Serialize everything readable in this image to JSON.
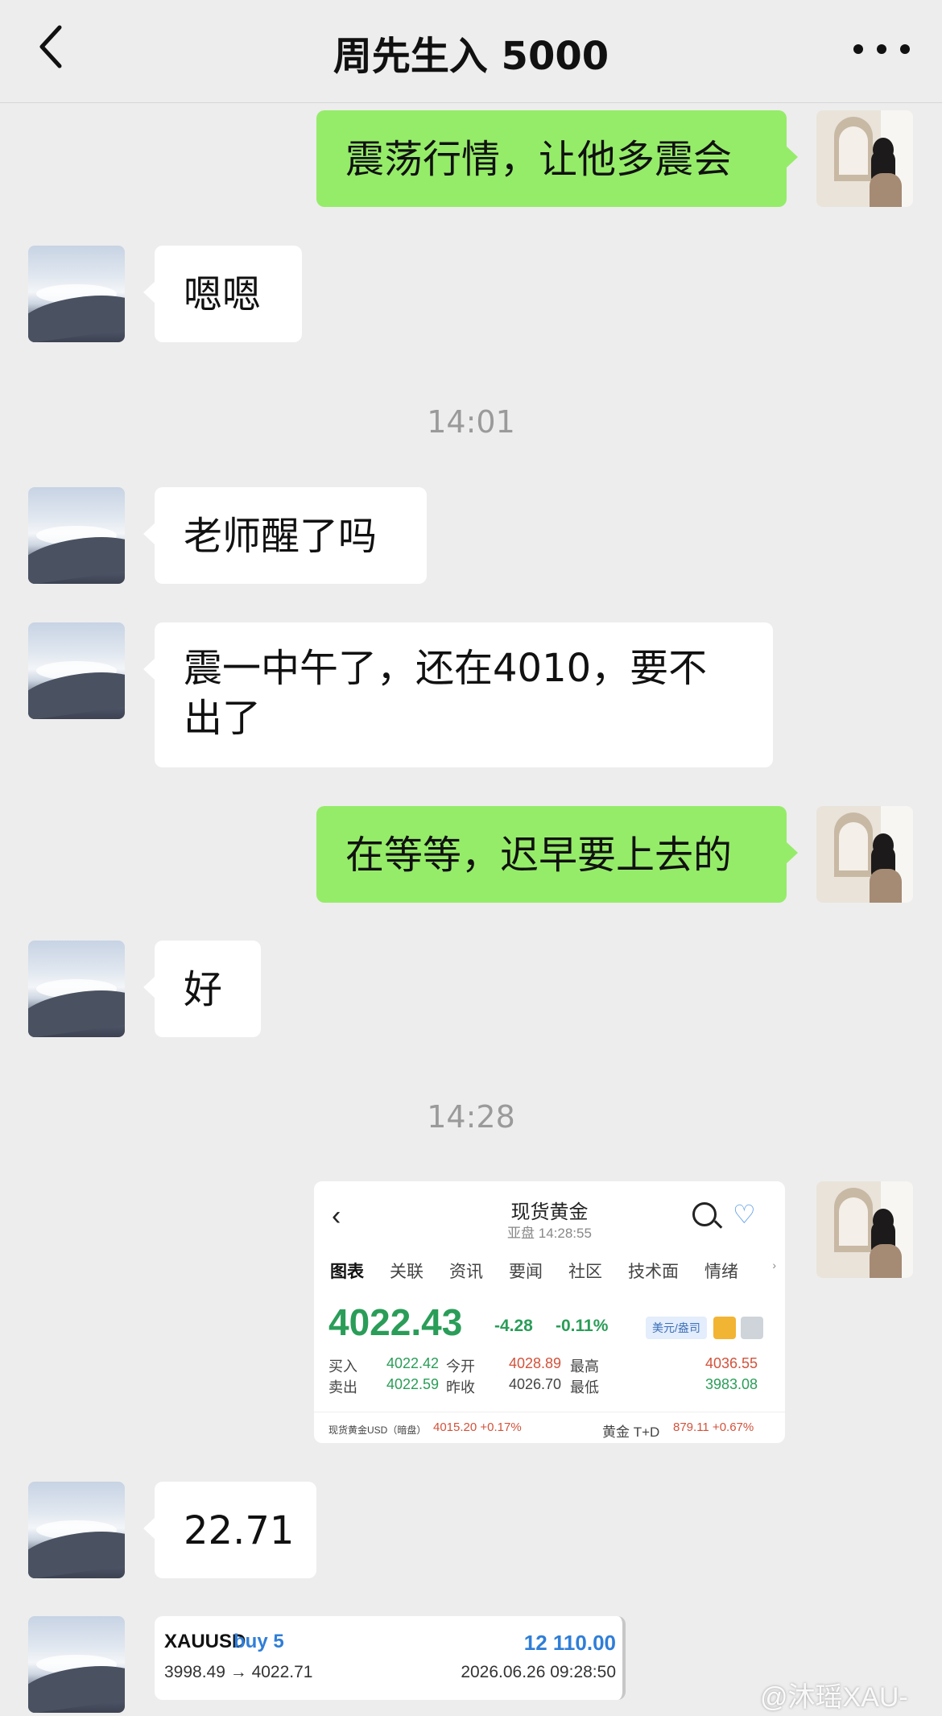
{
  "header": {
    "title": "周先生入 5000"
  },
  "messages": [
    {
      "from": "me",
      "text": "震荡行情，让他多震会"
    },
    {
      "from": "them",
      "text": "嗯嗯"
    },
    {
      "time": "14:01"
    },
    {
      "from": "them",
      "text": "老师醒了吗"
    },
    {
      "from": "them",
      "text_line1": "震一中午了，还在4010，要不",
      "text_line2": "出了"
    },
    {
      "from": "me",
      "text": "在等等，迟早要上去的"
    },
    {
      "from": "them",
      "text": "好"
    },
    {
      "time": "14:28"
    },
    {
      "from": "them",
      "text": "22.71"
    }
  ],
  "quote_screenshot": {
    "back_glyph": "‹",
    "title": "现货黄金",
    "subtitle": "亚盘 14:28:55",
    "heart_glyph": "♡",
    "tabs": [
      "图表",
      "关联",
      "资讯",
      "要闻",
      "社区",
      "技术面",
      "情绪"
    ],
    "tab_arrow": "›",
    "price": "4022.43",
    "change": "-4.28",
    "change_pct": "-0.11%",
    "unit_label": "美元/盎司",
    "row1": {
      "buy_label": "买入",
      "buy": "4022.42",
      "open_label": "今开",
      "open": "4028.89",
      "high_label": "最高",
      "high": "4036.55"
    },
    "row2": {
      "sell_label": "卖出",
      "sell": "4022.59",
      "prev_label": "昨收",
      "prev": "4026.70",
      "low_label": "最低",
      "low": "3983.08"
    },
    "footer": {
      "left_label": "现货黄金USD（暗盘）",
      "left_value": "4015.20 +0.17%",
      "right_label": "黄金 T+D",
      "right_value": "879.11 +0.67%"
    },
    "colors": {
      "up": "#2a9d58",
      "down": "#d2523b"
    }
  },
  "trade_card": {
    "symbol": "XAUUSD",
    "side": "buy 5",
    "pnl": "12 110.00",
    "prices": "3998.49 → 4022.71",
    "date": "2026.06.26 09:28:50"
  },
  "watermark": "@沐瑶XAU-"
}
